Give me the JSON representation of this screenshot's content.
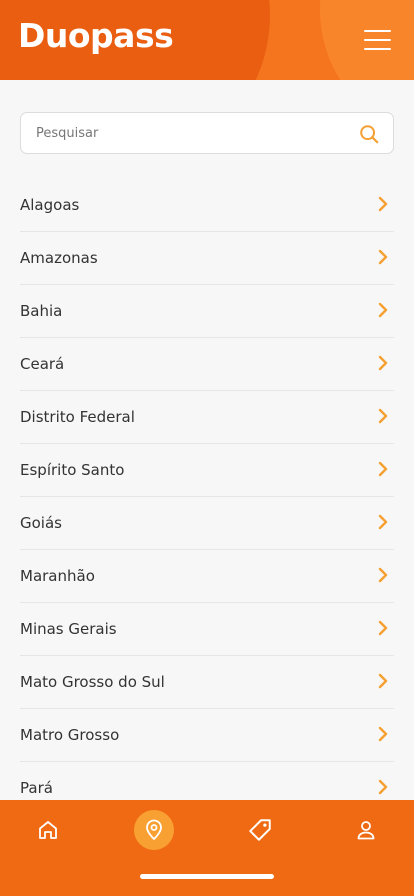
{
  "header": {
    "logo": "Duopass",
    "menu_icon": "hamburger-menu-icon"
  },
  "search": {
    "placeholder": "Pesquisar",
    "value": "",
    "icon": "search-icon"
  },
  "states": [
    {
      "label": "Alagoas"
    },
    {
      "label": "Amazonas"
    },
    {
      "label": "Bahia"
    },
    {
      "label": "Ceará"
    },
    {
      "label": "Distrito Federal"
    },
    {
      "label": "Espírito Santo"
    },
    {
      "label": "Goiás"
    },
    {
      "label": "Maranhão"
    },
    {
      "label": "Minas Gerais"
    },
    {
      "label": "Mato Grosso do Sul"
    },
    {
      "label": "Matro Grosso"
    },
    {
      "label": "Pará"
    }
  ],
  "bottom_nav": {
    "items": [
      {
        "icon": "home-icon",
        "active": false
      },
      {
        "icon": "location-pin-icon",
        "active": true
      },
      {
        "icon": "tag-icon",
        "active": false
      },
      {
        "icon": "profile-icon",
        "active": false
      }
    ]
  },
  "colors": {
    "brand_orange": "#ef6a13",
    "accent": "#f5a033",
    "active_nav": "#f9a032"
  }
}
